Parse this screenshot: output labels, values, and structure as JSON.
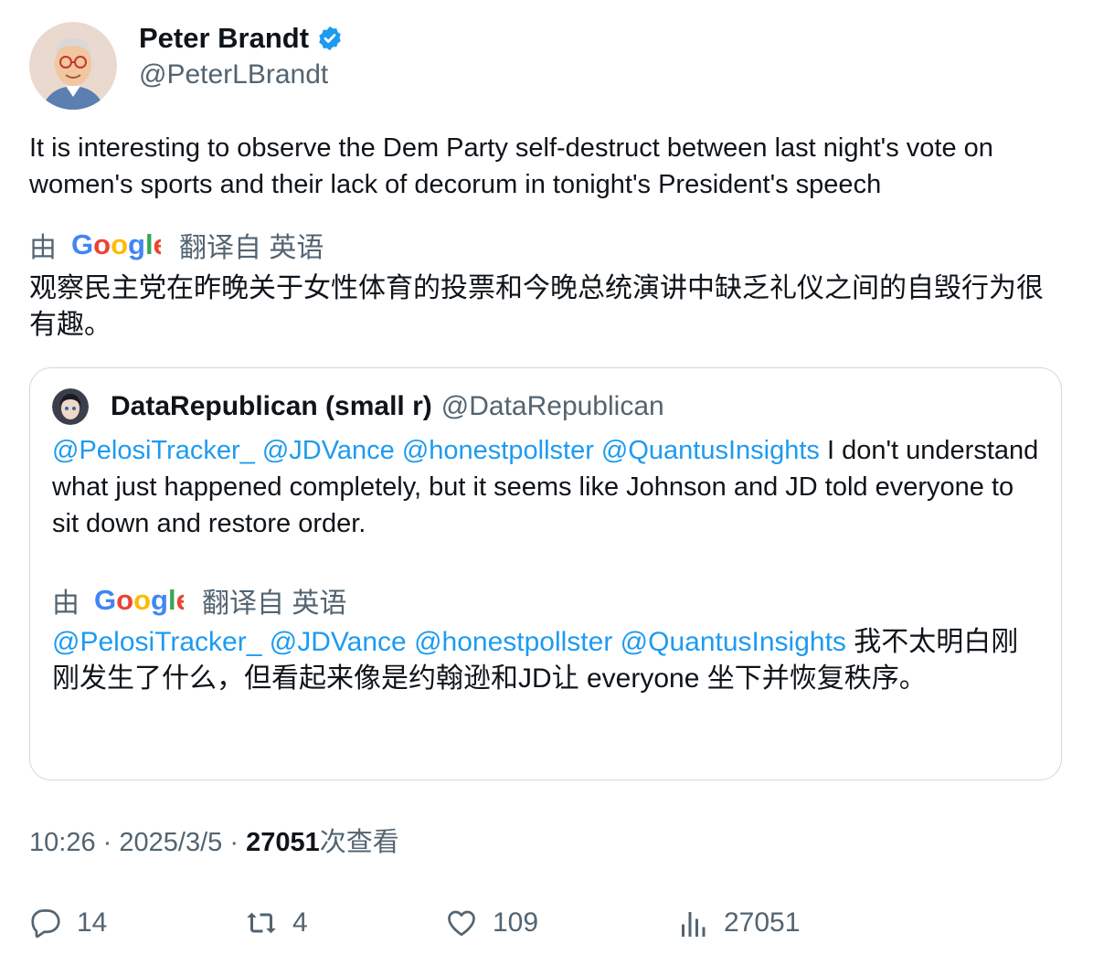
{
  "author": {
    "display_name": "Peter Brandt",
    "handle": "@PeterLBrandt",
    "verified": true,
    "avatar": "cartoon-man-with-glasses-avatar"
  },
  "tweet": {
    "text": "It is interesting to observe the Dem Party self-destruct between last night's vote on women's sports and their lack of decorum in tonight's President's speech",
    "translation_by": "由",
    "translation_from": "翻译自 英语",
    "translated_text": "观察民主党在昨晚关于女性体育的投票和今晚总统演讲中缺乏礼仪之间的自毁行为很有趣。"
  },
  "quote": {
    "display_name": "DataRepublican (small r)",
    "handle": "@DataRepublican",
    "avatar": "anime-character-avatar",
    "mentions": [
      "@PelosiTracker_",
      "@JDVance",
      "@honestpollster",
      "@QuantusInsights"
    ],
    "text": "I don't understand what just happened completely, but it seems like Johnson and JD told everyone to sit down and restore order.",
    "translation_by": "由",
    "translation_from": "翻译自 英语",
    "translated_text": "我不太明白刚刚发生了什么，但看起来像是约翰逊和JD让 everyone 坐下并恢复秩序。"
  },
  "meta": {
    "time": "10:26",
    "sep1": "·",
    "date": "2025/3/5",
    "sep2": "·",
    "views": "27051",
    "views_label": "次查看"
  },
  "actions": {
    "replies": "14",
    "retweets": "4",
    "likes": "109",
    "views": "27051"
  },
  "colors": {
    "link": "#1d9bf0",
    "secondary": "#536471",
    "primary": "#0f1419",
    "border": "#cfd9de"
  }
}
